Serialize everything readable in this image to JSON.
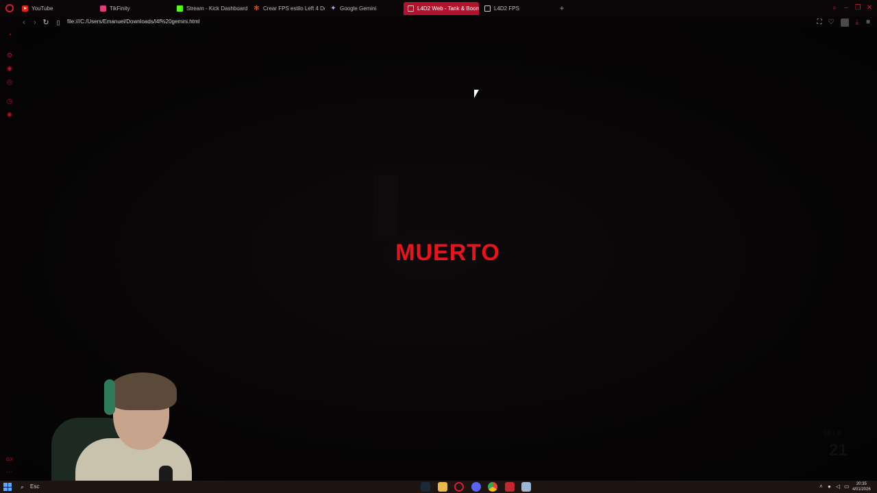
{
  "tabs": [
    {
      "label": "YouTube",
      "icon": "youtube-icon",
      "active": false
    },
    {
      "label": "TikFinity",
      "icon": "tikfinity-icon",
      "active": false
    },
    {
      "label": "Stream - Kick Dashboard",
      "icon": "kick-icon",
      "active": false
    },
    {
      "label": "Crear FPS estilo Left 4 De",
      "icon": "sparkle-icon",
      "active": false
    },
    {
      "label": "Google Gemini",
      "icon": "gemini-icon",
      "active": false
    },
    {
      "label": "L4D2 Web - Tank & Boom",
      "icon": "document-icon",
      "active": true
    },
    {
      "label": "L4D2 FPS",
      "icon": "document-icon",
      "active": false
    }
  ],
  "address_bar": {
    "url": "file:///C:/Users/Emanuel/Downloads/l4f%20gemini.html"
  },
  "game": {
    "status_text": "MUERTO",
    "hud_ammo_label": "00 / 0",
    "hud_ammo_value": "21"
  },
  "taskbar": {
    "search_text": "Esc",
    "clock_time": "20:35",
    "clock_date": "4/01/2026"
  },
  "colors": {
    "accent": "#b3122c",
    "death_text": "#e8141b",
    "background": "#050304"
  }
}
